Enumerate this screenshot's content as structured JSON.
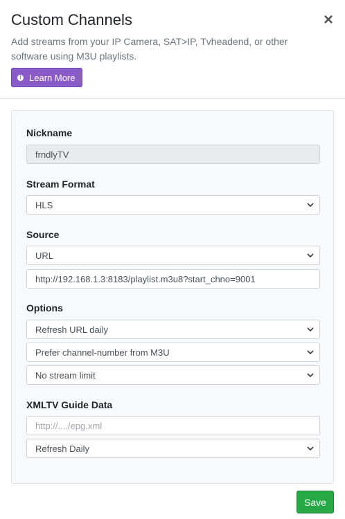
{
  "modal": {
    "title": "Custom Channels",
    "close_symbol": "×",
    "description": "Add streams from your IP Camera, SAT>IP, Tvheadend, or other software using M3U playlists.",
    "learn_more_label": "Learn More",
    "save_label": "Save"
  },
  "form": {
    "nickname": {
      "label": "Nickname",
      "value": "frndlyTV"
    },
    "stream_format": {
      "label": "Stream Format",
      "selected": "HLS"
    },
    "source": {
      "label": "Source",
      "type_selected": "URL",
      "url_value": "http://192.168.1.3:8183/playlist.m3u8?start_chno=9001"
    },
    "options": {
      "label": "Options",
      "refresh_selected": "Refresh URL daily",
      "channel_number_selected": "Prefer channel-number from M3U",
      "stream_limit_selected": "No stream limit"
    },
    "xmltv": {
      "label": "XMLTV Guide Data",
      "url_placeholder": "http://..../epg.xml",
      "refresh_selected": "Refresh Daily"
    }
  },
  "colors": {
    "learn_more_bg": "#8b5cc7",
    "save_bg": "#28a745"
  },
  "icons": [
    "info-icon",
    "close-icon",
    "chevron-down-icon"
  ]
}
